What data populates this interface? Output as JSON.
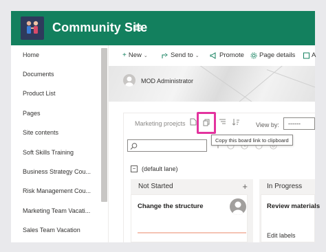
{
  "site": {
    "title": "Community Site",
    "header_color": "#13805e",
    "logo_icon": "site-logo-people",
    "teams_icon": "teams-icon"
  },
  "nav": {
    "items": [
      {
        "label": "Home"
      },
      {
        "label": "Documents"
      },
      {
        "label": "Product List"
      },
      {
        "label": "Pages"
      },
      {
        "label": "Site contents"
      },
      {
        "label": "Soft Skills Training"
      },
      {
        "label": "Business Strategy Cou..."
      },
      {
        "label": "Risk Management Cou..."
      },
      {
        "label": "Marketing Team Vacati..."
      },
      {
        "label": "Sales Team Vacation"
      }
    ]
  },
  "command_bar": {
    "new_label": "New",
    "send_to_label": "Send to",
    "promote_label": "Promote",
    "page_details_label": "Page details",
    "overflow_label": "A"
  },
  "banner": {
    "owner_name": "MOD Administrator"
  },
  "board": {
    "title": "Marketing proejcts",
    "view_by_label": "View by:",
    "view_by_value": "------",
    "search_placeholder": "",
    "tooltip": "Copy this board link to clipboard",
    "highlight_color": "#e3339e",
    "lane_toggle": "−",
    "lane_label": "(default lane)",
    "columns": [
      {
        "name": "Not Started",
        "add_symbol": "+",
        "cards": [
          {
            "title": "Change the structure"
          }
        ]
      },
      {
        "name": "In Progress",
        "cards": [
          {
            "title": "Review materials",
            "action": "Edit labels"
          }
        ]
      }
    ]
  }
}
